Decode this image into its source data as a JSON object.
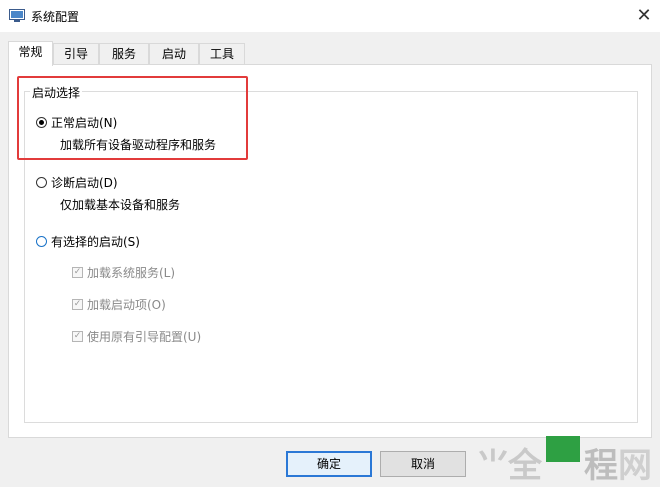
{
  "window": {
    "title": "系统配置"
  },
  "tabs": [
    {
      "label": "常规",
      "active": true
    },
    {
      "label": "引导",
      "active": false
    },
    {
      "label": "服务",
      "active": false
    },
    {
      "label": "启动",
      "active": false
    },
    {
      "label": "工具",
      "active": false
    }
  ],
  "startup": {
    "group_label": "启动选择",
    "normal": {
      "label": "正常启动(N)",
      "desc": "加载所有设备驱动程序和服务",
      "checked": true
    },
    "diagnostic": {
      "label": "诊断启动(D)",
      "desc": "仅加载基本设备和服务",
      "checked": false
    },
    "selective": {
      "label": "有选择的启动(S)",
      "checked": false
    },
    "options": [
      {
        "label": "加载系统服务(L)",
        "checked": true,
        "enabled": false
      },
      {
        "label": "加载启动项(O)",
        "checked": true,
        "enabled": false
      },
      {
        "label": "使用原有引导配置(U)",
        "checked": true,
        "enabled": false
      }
    ]
  },
  "buttons": {
    "ok": "确定",
    "cancel": "取消"
  },
  "colors": {
    "highlight": "#e23b3b",
    "default_button_border": "#2b78d6",
    "watermark_green": "#2ea043"
  }
}
